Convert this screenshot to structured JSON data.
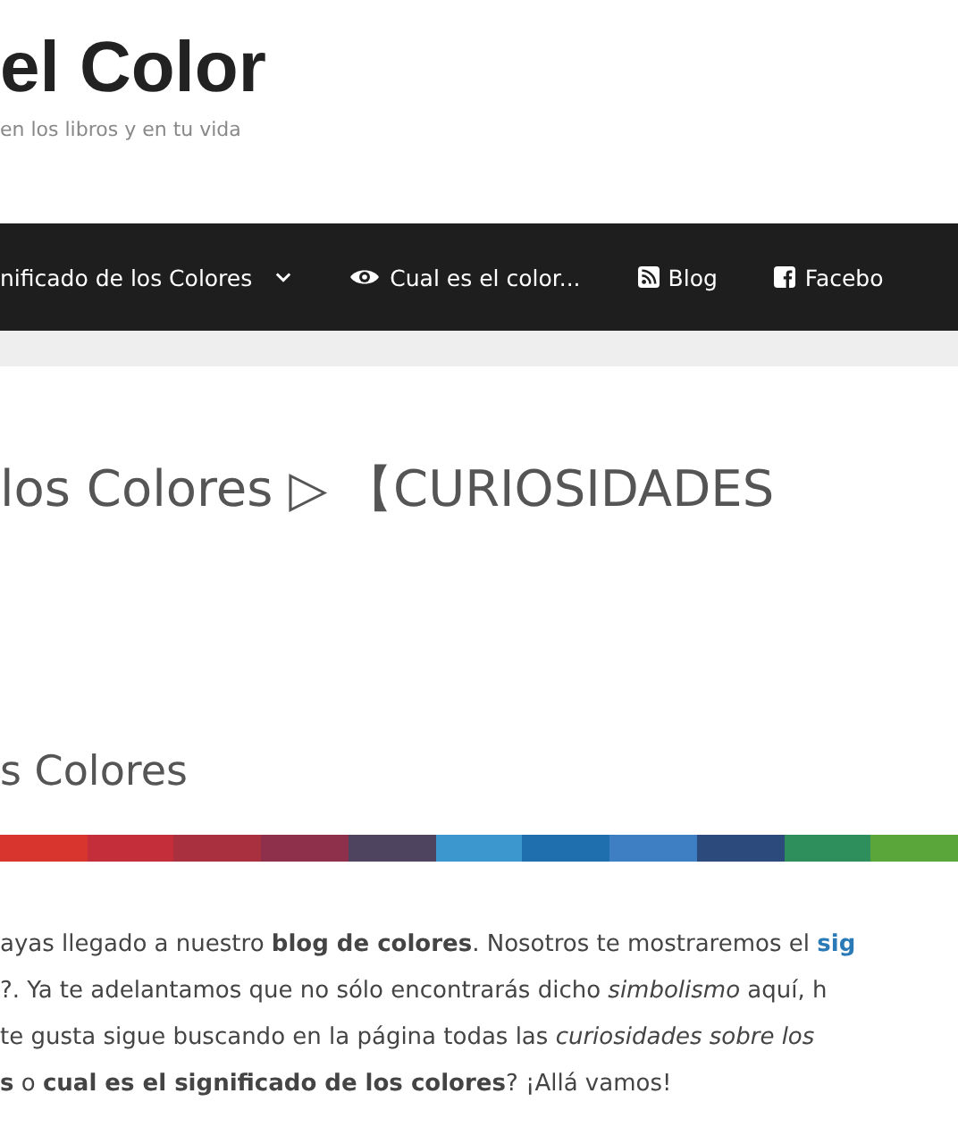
{
  "site": {
    "title": "el Color",
    "tagline": "en los libros y en tu vida"
  },
  "nav": [
    {
      "label": "nificado de los Colores",
      "kind": "dropdown"
    },
    {
      "label": "Cual es el color...",
      "kind": "eye"
    },
    {
      "label": "Blog",
      "kind": "feed"
    },
    {
      "label": "Facebo",
      "kind": "social"
    }
  ],
  "headline": "los Colores ▷ 【CURIOSIDADES",
  "section_heading": "s Colores",
  "paragraph_lines": [
    {
      "text": "ayas llegado a nuestro **blog de colores**. Nosotros te mostraremos el ",
      "link": "sig"
    },
    {
      "text": "?. Ya te adelantamos que no sólo encontrarás dicho *simbolismo* aquí, h"
    },
    {
      "text": "te gusta sigue buscando en la página todas las *curiosidades sobre los*"
    },
    {
      "text": "**s** o **cual es el significado de los colores**? ¡Allá vamos!"
    }
  ]
}
